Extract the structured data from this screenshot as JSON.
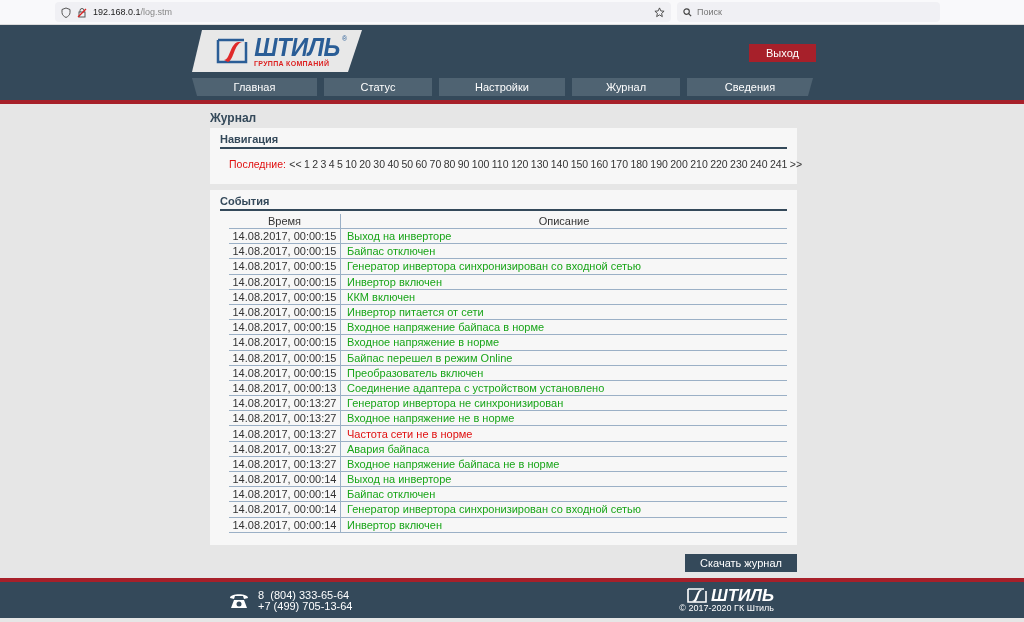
{
  "browser": {
    "url_host": "192.168.0.1",
    "url_path": "/log.stm",
    "search_placeholder": "Поиск"
  },
  "header": {
    "logo": {
      "name": "ШТИЛЬ",
      "mark": "®",
      "tagline": "ГРУППА КОМПАНИЙ"
    },
    "logout_button": "Выход",
    "nav": [
      {
        "label": "Главная",
        "selected": false
      },
      {
        "label": "Статус",
        "selected": false
      },
      {
        "label": "Настройки",
        "selected": false
      },
      {
        "label": "Журнал",
        "selected": false
      },
      {
        "label": "Сведения",
        "selected": false
      }
    ]
  },
  "page_title": "Журнал",
  "navigation": {
    "title": "Навигация",
    "label": "Последние:",
    "pages": [
      "<<",
      "1",
      "2",
      "3",
      "4",
      "5",
      "10",
      "20",
      "30",
      "40",
      "50",
      "60",
      "70",
      "80",
      "90",
      "100",
      "110",
      "120",
      "130",
      "140",
      "150",
      "160",
      "170",
      "180",
      "190",
      "200",
      "210",
      "220",
      "230",
      "240",
      "241",
      ">>"
    ]
  },
  "events": {
    "title": "События",
    "columns": [
      "Время",
      "Описание"
    ],
    "rows": [
      {
        "time": "14.08.2017, 00:00:15",
        "description": "Выход на инверторе",
        "color": "#19a519"
      },
      {
        "time": "14.08.2017, 00:00:15",
        "description": "Байпас отключен",
        "color": "#19a519"
      },
      {
        "time": "14.08.2017, 00:00:15",
        "description": "Генератор инвертора синхронизирован со входной сетью",
        "color": "#19a519"
      },
      {
        "time": "14.08.2017, 00:00:15",
        "description": "Инвертор включен",
        "color": "#19a519"
      },
      {
        "time": "14.08.2017, 00:00:15",
        "description": "ККМ включен",
        "color": "#19a519"
      },
      {
        "time": "14.08.2017, 00:00:15",
        "description": "Инвертор питается от сети",
        "color": "#19a519"
      },
      {
        "time": "14.08.2017, 00:00:15",
        "description": "Входное напряжение байпаса в норме",
        "color": "#19a519"
      },
      {
        "time": "14.08.2017, 00:00:15",
        "description": "Входное напряжение в норме",
        "color": "#19a519"
      },
      {
        "time": "14.08.2017, 00:00:15",
        "description": "Байпас перешел в режим Online",
        "color": "#19a519"
      },
      {
        "time": "14.08.2017, 00:00:15",
        "description": "Преобразователь включен",
        "color": "#19a519"
      },
      {
        "time": "14.08.2017, 00:00:13",
        "description": "Соединение адаптера с устройством установлено",
        "color": "#19a519"
      },
      {
        "time": "14.08.2017, 00:13:27",
        "description": "Генератор инвертора не синхронизирован",
        "color": "#19a519"
      },
      {
        "time": "14.08.2017, 00:13:27",
        "description": "Входное напряжение не в норме",
        "color": "#19a519"
      },
      {
        "time": "14.08.2017, 00:13:27",
        "description": "Частота сети не в норме",
        "color": "#e01010"
      },
      {
        "time": "14.08.2017, 00:13:27",
        "description": "Авария байпаса",
        "color": "#19a519"
      },
      {
        "time": "14.08.2017, 00:13:27",
        "description": "Входное напряжение байпаса не в норме",
        "color": "#19a519"
      },
      {
        "time": "14.08.2017, 00:00:14",
        "description": "Выход на инверторе",
        "color": "#19a519"
      },
      {
        "time": "14.08.2017, 00:00:14",
        "description": "Байпас отключен",
        "color": "#19a519"
      },
      {
        "time": "14.08.2017, 00:00:14",
        "description": "Генератор инвертора синхронизирован со входной сетью",
        "color": "#19a519"
      },
      {
        "time": "14.08.2017, 00:00:14",
        "description": "Инвертор включен",
        "color": "#19a519"
      }
    ]
  },
  "download_button": "Скачать журнал",
  "footer": {
    "phones": [
      "8  (804) 333-65-64",
      "+7 (499) 705-13-64"
    ],
    "logo": "ШТИЛЬ",
    "copyright": "© 2017-2020 ГК Штиль"
  }
}
